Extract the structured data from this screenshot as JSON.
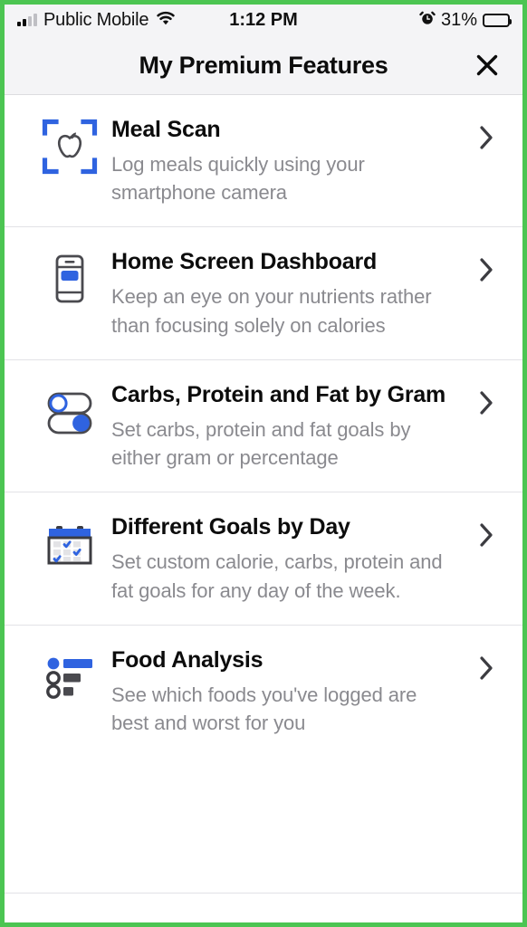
{
  "status_bar": {
    "carrier": "Public Mobile",
    "signal_icon": "signal-bars-icon",
    "wifi_icon": "wifi-icon",
    "time": "1:12 PM",
    "alarm_icon": "alarm-clock-icon",
    "battery_percent": "31%",
    "battery_level": 31,
    "battery_icon": "battery-icon"
  },
  "header": {
    "title": "My Premium Features",
    "close_icon": "close-icon"
  },
  "colors": {
    "accent_blue": "#2f63e0",
    "icon_gray": "#4a4a4f",
    "text_primary": "#0c0c0c",
    "text_secondary": "#8a8a8f",
    "frame_green": "#4cc552",
    "header_bg": "#f4f4f6"
  },
  "features": [
    {
      "icon": "meal-scan-icon",
      "title": "Meal Scan",
      "description": "Log meals quickly using your smartphone camera",
      "chevron_icon": "chevron-right-icon"
    },
    {
      "icon": "home-screen-dashboard-icon",
      "title": "Home Screen Dashboard",
      "description": "Keep an eye on your nutrients rather than focusing solely on calories",
      "chevron_icon": "chevron-right-icon"
    },
    {
      "icon": "toggle-switches-icon",
      "title": "Carbs, Protein and Fat by Gram",
      "description": "Set carbs, protein and fat goals by either gram or percentage",
      "chevron_icon": "chevron-right-icon"
    },
    {
      "icon": "calendar-checks-icon",
      "title": "Different Goals by Day",
      "description": "Set custom calorie, carbs, protein and fat goals for any day of the week.",
      "chevron_icon": "chevron-right-icon"
    },
    {
      "icon": "ranked-bars-icon",
      "title": "Food Analysis",
      "description": "See which foods you've logged are best and worst for you",
      "chevron_icon": "chevron-right-icon"
    }
  ]
}
